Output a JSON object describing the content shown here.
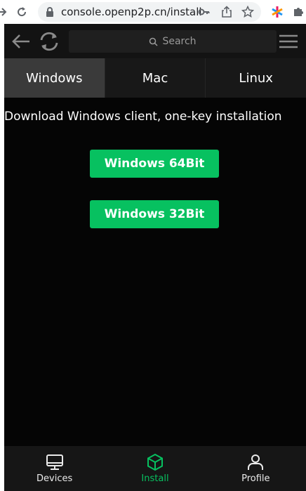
{
  "browser": {
    "url": "console.openp2p.cn/install"
  },
  "app": {
    "search_placeholder": "Search",
    "tabs": [
      {
        "label": "Windows",
        "active": true
      },
      {
        "label": "Mac",
        "active": false
      },
      {
        "label": "Linux",
        "active": false
      }
    ],
    "intro_text": "Download Windows client, one-key installation",
    "buttons": {
      "win64": "Windows 64Bit",
      "win32": "Windows 32Bit"
    },
    "bottom_nav": [
      {
        "label": "Devices",
        "icon": "monitor-icon",
        "active": false
      },
      {
        "label": "Install",
        "icon": "package-icon",
        "active": true
      },
      {
        "label": "Profile",
        "icon": "user-icon",
        "active": false
      }
    ]
  },
  "colors": {
    "accent": "#07c160",
    "background": "#050505",
    "active_tab": "#3a3a3a"
  }
}
